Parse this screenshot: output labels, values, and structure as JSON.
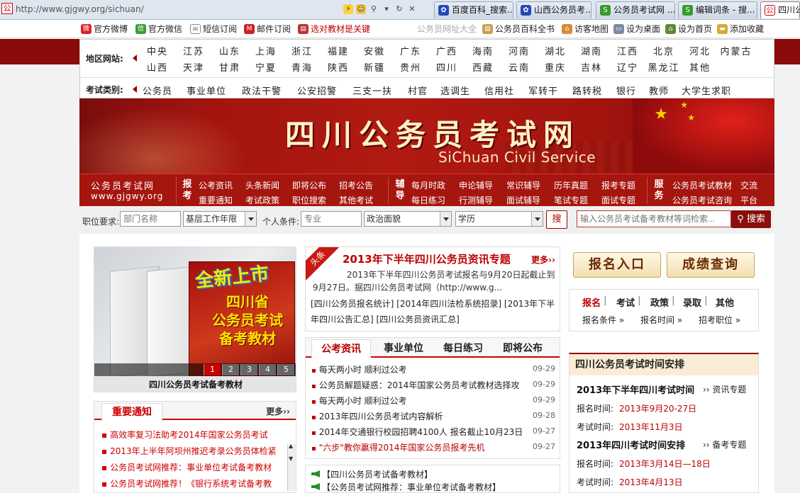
{
  "browser": {
    "url": "http://www.gjgwy.org/sichuan/",
    "tabs": [
      {
        "label": "百度百科_搜索..."
      },
      {
        "label": "山西公务员考..."
      },
      {
        "label": "公务员考试网 ..."
      },
      {
        "label": "编辑词条 - 搜..."
      },
      {
        "label": "四川公"
      }
    ]
  },
  "topbar": {
    "items": [
      "官方微博",
      "官方微信",
      "短信订阅",
      "邮件订阅",
      "选对教材是关键"
    ],
    "right": [
      "公务员网址大全",
      "公务员百科全书",
      "访客地图",
      "设为桌面",
      "设为首页",
      "添加收藏"
    ]
  },
  "nav": {
    "region_label": "地区网站:",
    "regions_row1": [
      "中央",
      "江苏",
      "山东",
      "上海",
      "浙江",
      "福建",
      "安徽",
      "广东",
      "广西",
      "海南",
      "河南",
      "湖北",
      "湖南",
      "江西",
      "北京",
      "河北",
      "内蒙古"
    ],
    "regions_row2": [
      "山西",
      "天津",
      "甘肃",
      "宁夏",
      "青海",
      "陕西",
      "新疆",
      "贵州",
      "四川",
      "西藏",
      "云南",
      "重庆",
      "吉林",
      "辽宁",
      "黑龙江",
      "其他"
    ],
    "category_label": "考试类别:",
    "categories": [
      "公务员",
      "事业单位",
      "政法干警",
      "公安招警",
      "三支一扶",
      "村官",
      "选调生",
      "信用社",
      "军转干",
      "路转税",
      "银行",
      "教师",
      "大学生求职"
    ]
  },
  "banner": {
    "title": "四川公务员考试网",
    "subtitle": "SiChuan Civil Service"
  },
  "menu": {
    "brand_line1": "公务员考试网",
    "brand_line2": "www.gjgwy.org",
    "tag1": "报考",
    "group1_row1": [
      "公考资讯",
      "头条新闻",
      "即将公布",
      "招考公告"
    ],
    "group1_row2": [
      "重要通知",
      "考试政策",
      "职位搜索",
      "其他考试"
    ],
    "tag2": "辅导",
    "group2_row1": [
      "每月时政",
      "申论辅导",
      "常识辅导",
      "历年真题",
      "报考专题"
    ],
    "group2_row2": [
      "每日练习",
      "行测辅导",
      "面试辅导",
      "笔试专题",
      "面试专题"
    ],
    "tag3": "服务",
    "group3_row1": [
      "公务员考试教材",
      "交流"
    ],
    "group3_row2": [
      "公务员考试咨询",
      "平台"
    ]
  },
  "search": {
    "job_label": "职位要求:",
    "dept_placeholder": "部门名称",
    "work_years": "基层工作年限",
    "person_label": "个人条件:",
    "major_placeholder": "专业",
    "politics": "政治面貌",
    "education": "学历",
    "go_label": "搜",
    "keyword_placeholder": "输入公务员考试备考教材等词检索...",
    "keyword_button": "搜索"
  },
  "slider": {
    "badge": "全新上市",
    "line1": "四川省",
    "line2": "公务员考试",
    "line3": "备考教材",
    "pages": [
      "1",
      "2",
      "3",
      "4",
      "5"
    ],
    "caption": "四川公务员考试备考教材"
  },
  "notice": {
    "title": "重要通知",
    "more": "更多››",
    "items": [
      "高效率复习法助考2014年国家公务员考试",
      "2013年上半年阿坝州推迟考录公务员体检紧",
      "公务员考试网推荐：事业单位考试备考教材",
      "公务员考试网推荐！《银行系统考试备考教"
    ]
  },
  "headline": {
    "ribbon": "头条",
    "title": "2013年下半年四川公务员资讯专题",
    "more": "更多››",
    "body": "2013年下半年四川公务员考试报名与9月20日起截止到9月27日。据四川公务员考试网（http://www.g...",
    "links": "[四川公务员报名统计]  [2014年四川法检系统招录]  [2013年下半年四川公告汇总]  [四川公务员资讯汇总]"
  },
  "news": {
    "tabs": [
      "公考资讯",
      "事业单位",
      "每日练习",
      "即将公布"
    ],
    "items": [
      {
        "title": "每天两小时 顺利过公考",
        "date": "09-29"
      },
      {
        "title": "公务员解题疑惑：2014年国家公务员考试教材选择攻",
        "date": "09-29"
      },
      {
        "title": "每天两小时 顺利过公考",
        "date": "09-29"
      },
      {
        "title": "2013年四川公务员考试内容解析",
        "date": "09-28"
      },
      {
        "title": "2014年交通银行校园招聘4100人 报名截止10月23日",
        "date": "09-27"
      },
      {
        "title": "\"六步\"教你赢得2014年国家公务员报考先机",
        "date": "09-27"
      }
    ]
  },
  "audio": {
    "items": [
      "【四川公务员考试备考教材】",
      "【公务员考试网推荐：事业单位考试备考教材】"
    ]
  },
  "right": {
    "register": "报名入口",
    "score": "成绩查询",
    "quick": [
      "报名",
      "考试",
      "政策",
      "录取",
      "其他"
    ],
    "quick_sub": [
      "报名条件 »",
      "报名时间 »",
      "招考职位 »"
    ],
    "schedule_title": "四川公务员考试时间安排",
    "s1_title": "2013年下半年四川考试时间",
    "s1_link": "›› 资讯专题",
    "s1_reg_label": "报名时间:",
    "s1_reg": "2013年9月20-27日",
    "s1_exam_label": "考试时间:",
    "s1_exam": "2013年11月3日",
    "s2_title": "2013年四川考试时间安排",
    "s2_link": "›› 备考专题",
    "s2_reg_label": "报名时间:",
    "s2_reg": "2013年3月14日—18日",
    "s2_exam_label": "考试时间:",
    "s2_exam": "2013年4月13日"
  },
  "colors": {
    "accent": "#a5160e",
    "link_red": "#b00000"
  }
}
